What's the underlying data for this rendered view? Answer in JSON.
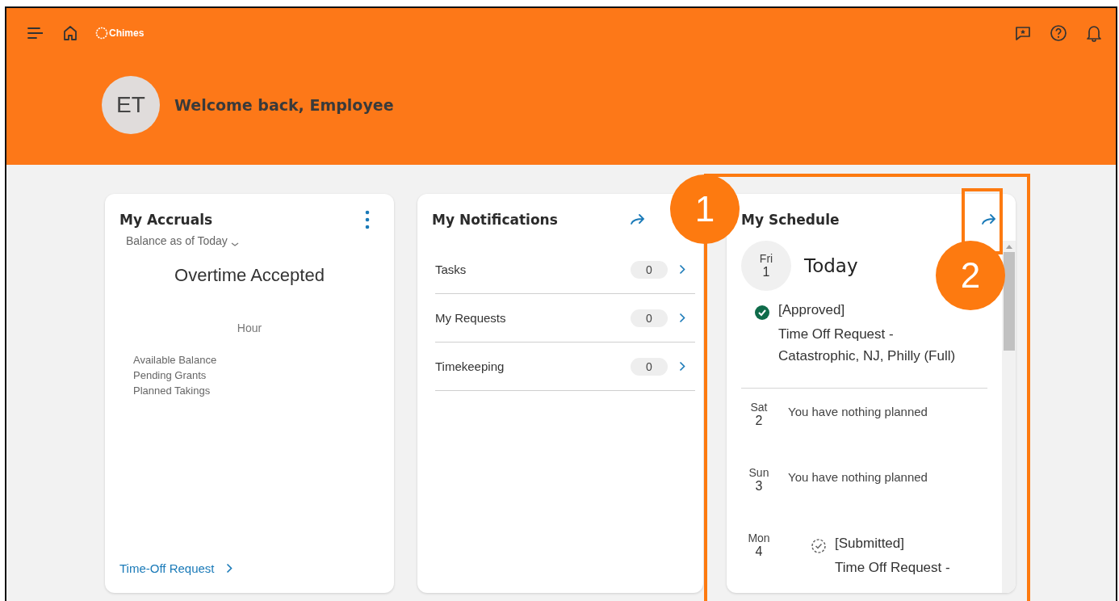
{
  "header": {
    "logo": "Chimes",
    "avatar": "ET",
    "welcome": "Welcome back, Employee"
  },
  "accruals": {
    "title": "My Accruals",
    "period": "Balance as of Today",
    "type": "Overtime Accepted",
    "unit": "Hour",
    "rows": [
      "Available Balance",
      "Pending Grants",
      "Planned Takings"
    ],
    "link": "Time-Off Request"
  },
  "notifications": {
    "title": "My Notifications",
    "items": [
      {
        "label": "Tasks",
        "count": "0"
      },
      {
        "label": "My Requests",
        "count": "0"
      },
      {
        "label": "Timekeeping",
        "count": "0"
      }
    ]
  },
  "schedule": {
    "title": "My Schedule",
    "days": [
      {
        "weekday": "Fri",
        "day": "1",
        "today": true,
        "heading": "Today",
        "events": [
          {
            "kind": "approved",
            "label": "[Approved]",
            "text": "Time Off Request - Catastrophic, NJ, Philly (Full)"
          }
        ]
      },
      {
        "weekday": "Sat",
        "day": "2",
        "today": false,
        "empty_text": "You have nothing planned"
      },
      {
        "weekday": "Sun",
        "day": "3",
        "today": false,
        "empty_text": "You have nothing planned"
      },
      {
        "weekday": "Mon",
        "day": "4",
        "today": false,
        "events": [
          {
            "kind": "submitted",
            "label": "[Submitted]",
            "text": "Time Off Request -"
          }
        ]
      }
    ]
  },
  "annotations": [
    {
      "label": "1"
    },
    {
      "label": "2"
    }
  ]
}
